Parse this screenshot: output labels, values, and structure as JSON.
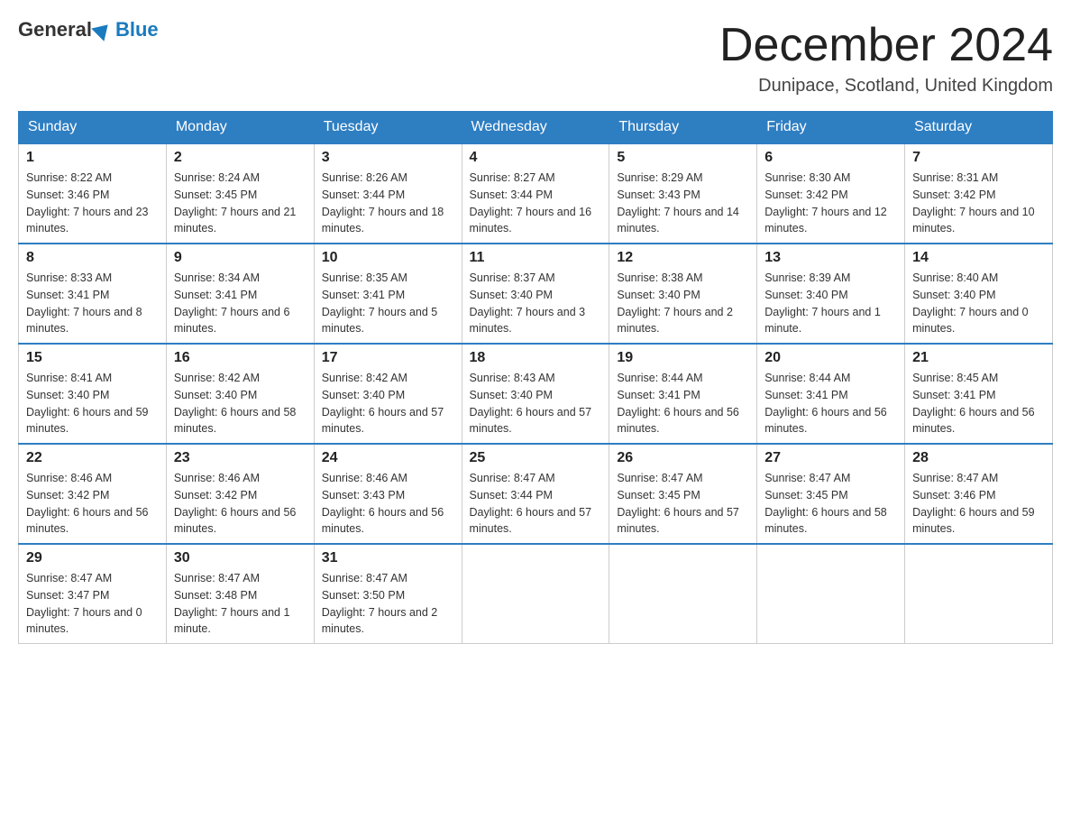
{
  "header": {
    "logo_general": "General",
    "logo_blue": "Blue",
    "month_title": "December 2024",
    "location": "Dunipace, Scotland, United Kingdom"
  },
  "days_of_week": [
    "Sunday",
    "Monday",
    "Tuesday",
    "Wednesday",
    "Thursday",
    "Friday",
    "Saturday"
  ],
  "weeks": [
    [
      {
        "day": "1",
        "sunrise": "Sunrise: 8:22 AM",
        "sunset": "Sunset: 3:46 PM",
        "daylight": "Daylight: 7 hours and 23 minutes."
      },
      {
        "day": "2",
        "sunrise": "Sunrise: 8:24 AM",
        "sunset": "Sunset: 3:45 PM",
        "daylight": "Daylight: 7 hours and 21 minutes."
      },
      {
        "day": "3",
        "sunrise": "Sunrise: 8:26 AM",
        "sunset": "Sunset: 3:44 PM",
        "daylight": "Daylight: 7 hours and 18 minutes."
      },
      {
        "day": "4",
        "sunrise": "Sunrise: 8:27 AM",
        "sunset": "Sunset: 3:44 PM",
        "daylight": "Daylight: 7 hours and 16 minutes."
      },
      {
        "day": "5",
        "sunrise": "Sunrise: 8:29 AM",
        "sunset": "Sunset: 3:43 PM",
        "daylight": "Daylight: 7 hours and 14 minutes."
      },
      {
        "day": "6",
        "sunrise": "Sunrise: 8:30 AM",
        "sunset": "Sunset: 3:42 PM",
        "daylight": "Daylight: 7 hours and 12 minutes."
      },
      {
        "day": "7",
        "sunrise": "Sunrise: 8:31 AM",
        "sunset": "Sunset: 3:42 PM",
        "daylight": "Daylight: 7 hours and 10 minutes."
      }
    ],
    [
      {
        "day": "8",
        "sunrise": "Sunrise: 8:33 AM",
        "sunset": "Sunset: 3:41 PM",
        "daylight": "Daylight: 7 hours and 8 minutes."
      },
      {
        "day": "9",
        "sunrise": "Sunrise: 8:34 AM",
        "sunset": "Sunset: 3:41 PM",
        "daylight": "Daylight: 7 hours and 6 minutes."
      },
      {
        "day": "10",
        "sunrise": "Sunrise: 8:35 AM",
        "sunset": "Sunset: 3:41 PM",
        "daylight": "Daylight: 7 hours and 5 minutes."
      },
      {
        "day": "11",
        "sunrise": "Sunrise: 8:37 AM",
        "sunset": "Sunset: 3:40 PM",
        "daylight": "Daylight: 7 hours and 3 minutes."
      },
      {
        "day": "12",
        "sunrise": "Sunrise: 8:38 AM",
        "sunset": "Sunset: 3:40 PM",
        "daylight": "Daylight: 7 hours and 2 minutes."
      },
      {
        "day": "13",
        "sunrise": "Sunrise: 8:39 AM",
        "sunset": "Sunset: 3:40 PM",
        "daylight": "Daylight: 7 hours and 1 minute."
      },
      {
        "day": "14",
        "sunrise": "Sunrise: 8:40 AM",
        "sunset": "Sunset: 3:40 PM",
        "daylight": "Daylight: 7 hours and 0 minutes."
      }
    ],
    [
      {
        "day": "15",
        "sunrise": "Sunrise: 8:41 AM",
        "sunset": "Sunset: 3:40 PM",
        "daylight": "Daylight: 6 hours and 59 minutes."
      },
      {
        "day": "16",
        "sunrise": "Sunrise: 8:42 AM",
        "sunset": "Sunset: 3:40 PM",
        "daylight": "Daylight: 6 hours and 58 minutes."
      },
      {
        "day": "17",
        "sunrise": "Sunrise: 8:42 AM",
        "sunset": "Sunset: 3:40 PM",
        "daylight": "Daylight: 6 hours and 57 minutes."
      },
      {
        "day": "18",
        "sunrise": "Sunrise: 8:43 AM",
        "sunset": "Sunset: 3:40 PM",
        "daylight": "Daylight: 6 hours and 57 minutes."
      },
      {
        "day": "19",
        "sunrise": "Sunrise: 8:44 AM",
        "sunset": "Sunset: 3:41 PM",
        "daylight": "Daylight: 6 hours and 56 minutes."
      },
      {
        "day": "20",
        "sunrise": "Sunrise: 8:44 AM",
        "sunset": "Sunset: 3:41 PM",
        "daylight": "Daylight: 6 hours and 56 minutes."
      },
      {
        "day": "21",
        "sunrise": "Sunrise: 8:45 AM",
        "sunset": "Sunset: 3:41 PM",
        "daylight": "Daylight: 6 hours and 56 minutes."
      }
    ],
    [
      {
        "day": "22",
        "sunrise": "Sunrise: 8:46 AM",
        "sunset": "Sunset: 3:42 PM",
        "daylight": "Daylight: 6 hours and 56 minutes."
      },
      {
        "day": "23",
        "sunrise": "Sunrise: 8:46 AM",
        "sunset": "Sunset: 3:42 PM",
        "daylight": "Daylight: 6 hours and 56 minutes."
      },
      {
        "day": "24",
        "sunrise": "Sunrise: 8:46 AM",
        "sunset": "Sunset: 3:43 PM",
        "daylight": "Daylight: 6 hours and 56 minutes."
      },
      {
        "day": "25",
        "sunrise": "Sunrise: 8:47 AM",
        "sunset": "Sunset: 3:44 PM",
        "daylight": "Daylight: 6 hours and 57 minutes."
      },
      {
        "day": "26",
        "sunrise": "Sunrise: 8:47 AM",
        "sunset": "Sunset: 3:45 PM",
        "daylight": "Daylight: 6 hours and 57 minutes."
      },
      {
        "day": "27",
        "sunrise": "Sunrise: 8:47 AM",
        "sunset": "Sunset: 3:45 PM",
        "daylight": "Daylight: 6 hours and 58 minutes."
      },
      {
        "day": "28",
        "sunrise": "Sunrise: 8:47 AM",
        "sunset": "Sunset: 3:46 PM",
        "daylight": "Daylight: 6 hours and 59 minutes."
      }
    ],
    [
      {
        "day": "29",
        "sunrise": "Sunrise: 8:47 AM",
        "sunset": "Sunset: 3:47 PM",
        "daylight": "Daylight: 7 hours and 0 minutes."
      },
      {
        "day": "30",
        "sunrise": "Sunrise: 8:47 AM",
        "sunset": "Sunset: 3:48 PM",
        "daylight": "Daylight: 7 hours and 1 minute."
      },
      {
        "day": "31",
        "sunrise": "Sunrise: 8:47 AM",
        "sunset": "Sunset: 3:50 PM",
        "daylight": "Daylight: 7 hours and 2 minutes."
      },
      null,
      null,
      null,
      null
    ]
  ]
}
